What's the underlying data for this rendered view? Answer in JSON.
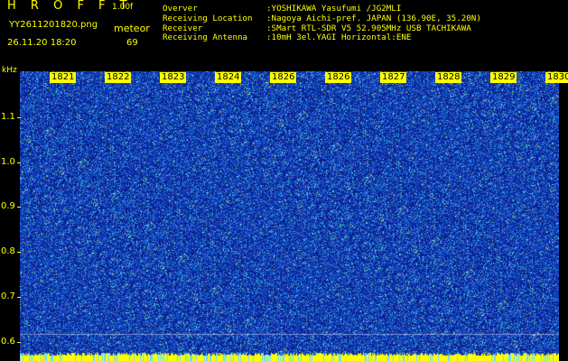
{
  "header": {
    "brand": "H R O F F T",
    "version": "1.00f",
    "filename": "YY2611201820.png",
    "meteor_label": "meteor",
    "datetime": "26.11.20 18:20",
    "meteor_count": "69"
  },
  "info": [
    {
      "key": "Overver",
      "value": ":YOSHIKAWA Yasufumi /JG2MLI"
    },
    {
      "key": "Receiving Location",
      "value": ":Nagoya Aichi-pref. JAPAN (136.90E, 35.20N)"
    },
    {
      "key": "Receiver",
      "value": ":SMart RTL-SDR V5 52.905MHz USB TACHIKAWA"
    },
    {
      "key": "Receiving Antenna",
      "value": ":10mH 3el.YAGI Horizontal:ENE"
    }
  ],
  "axis": {
    "unit": "kHz",
    "y_ticks": [
      "1.1",
      "1.0",
      "0.9",
      "0.8",
      "0.7",
      "0.6"
    ],
    "x_ticks": [
      "1821",
      "1822",
      "1823",
      "1824",
      "1826",
      "1826",
      "1827",
      "1828",
      "1829",
      "1830"
    ]
  },
  "colors": {
    "background": "#000000",
    "accent": "#ffff00",
    "spectrum_base": "#1a3aa8"
  }
}
